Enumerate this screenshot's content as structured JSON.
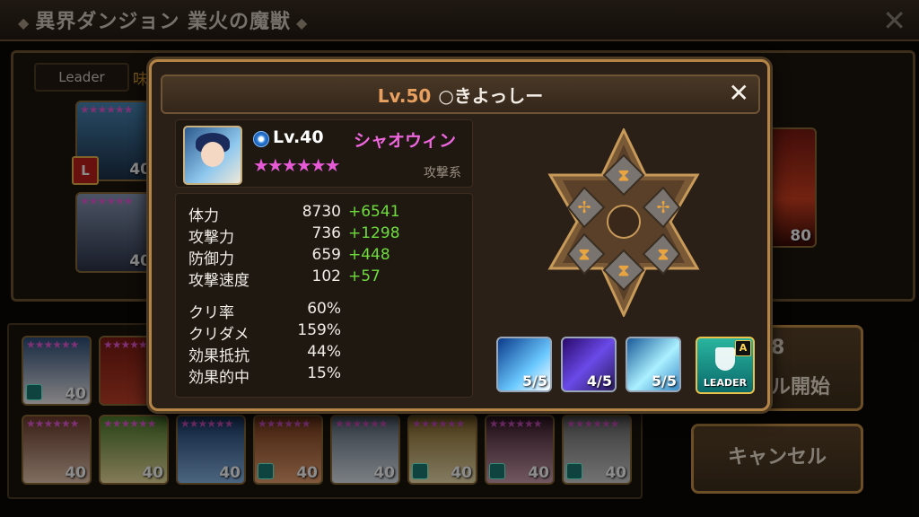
{
  "header": {
    "title": "異界ダンジョン 業火の魔獣",
    "diamond_left": "◆",
    "diamond_right": "◆",
    "close_label": "✕"
  },
  "team": {
    "leader_tab": "Leader",
    "side_label": "味",
    "leader_badge": "L",
    "slots": [
      {
        "stars": "★★★★★★",
        "level": "40"
      },
      {
        "stars": "★★★★★★",
        "level": "40"
      },
      {
        "stars": "",
        "level": "80"
      }
    ]
  },
  "inventory": {
    "row1": [
      {
        "stars": "★★★★★★",
        "level": "40"
      },
      {
        "stars": "★★★★★★",
        "level": "4"
      }
    ],
    "row2": [
      {
        "stars": "★★★★★★",
        "level": "40"
      },
      {
        "stars": "★★★★★★",
        "level": "40"
      },
      {
        "stars": "★★★★★★",
        "level": "40"
      },
      {
        "stars": "★★★★★★",
        "level": "40"
      },
      {
        "stars": "★★★★★★",
        "level": "40"
      },
      {
        "stars": "★★★★★★",
        "level": "40"
      },
      {
        "stars": "★★★★★★",
        "level": "40"
      },
      {
        "stars": "★★★★★★",
        "level": "40"
      }
    ]
  },
  "buttons": {
    "battle_count": "8",
    "battle_label": "ル開始",
    "cancel_label": "キャンセル"
  },
  "detail": {
    "player_level": "Lv.50",
    "player_name": "○きよっしー",
    "close_label": "✕",
    "monster": {
      "level": "Lv.40",
      "name": "シャオウィン",
      "stars": "★★★★★★",
      "type": "攻撃系"
    },
    "stats": [
      {
        "name": "体力",
        "value": "8730",
        "bonus": "+6541"
      },
      {
        "name": "攻撃力",
        "value": "736",
        "bonus": "+1298"
      },
      {
        "name": "防御力",
        "value": "659",
        "bonus": "+448"
      },
      {
        "name": "攻撃速度",
        "value": "102",
        "bonus": "+57"
      }
    ],
    "sub_stats": [
      {
        "name": "クリ率",
        "value": "60%"
      },
      {
        "name": "クリダメ",
        "value": "159%"
      },
      {
        "name": "効果抵抗",
        "value": "44%"
      },
      {
        "name": "効果的中",
        "value": "15%"
      }
    ],
    "skills": [
      {
        "level": "5/5"
      },
      {
        "level": "4/5"
      },
      {
        "level": "5/5"
      }
    ],
    "leader_skill": {
      "label": "LEADER",
      "grade": "A"
    }
  },
  "colors": {
    "accent": "#b58447",
    "star": "#e65ad6",
    "bonus": "#6fdc3e",
    "name": "#ee66dd"
  }
}
